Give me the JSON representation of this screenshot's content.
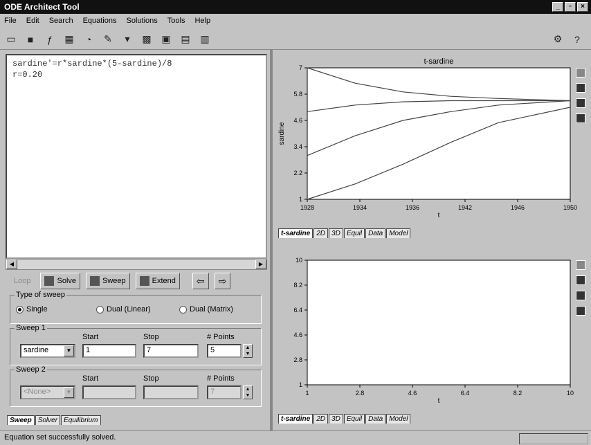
{
  "window": {
    "title": "ODE Architect Tool",
    "controls": [
      "_",
      "▫",
      "×"
    ]
  },
  "menu": [
    "File",
    "Edit",
    "Search",
    "Equations",
    "Solutions",
    "Tools",
    "Help"
  ],
  "editor": {
    "lines": [
      "sardine'=r*sardine*(5-sardine)/8",
      "r=0.20"
    ]
  },
  "actions": {
    "solve": "Solve",
    "sweep": "Sweep",
    "extend": "Extend",
    "back": "⇦",
    "forward": "⇨",
    "disabled": "Loop"
  },
  "sweep": {
    "type_label": "Type of sweep",
    "types": [
      "Single",
      "Dual (Linear)",
      "Dual (Matrix)"
    ],
    "selected_type": "Single",
    "sweep1": {
      "label": "Sweep 1",
      "start_label": "Start",
      "stop_label": "Stop",
      "points_label": "# Points",
      "variable": "sardine",
      "start": "1",
      "stop": "7",
      "points": "5"
    },
    "sweep2": {
      "label": "Sweep 2",
      "start_label": "Start",
      "stop_label": "Stop",
      "points_label": "# Points",
      "variable": "<None>",
      "start": "",
      "stop": "",
      "points": "7"
    }
  },
  "left_tabs": [
    "Sweep",
    "Solver",
    "Equilibrium"
  ],
  "top_plot": {
    "tabs": [
      "t-sardine",
      "2D",
      "3D",
      "Equil",
      "Data",
      "Model"
    ]
  },
  "bottom_plot": {
    "tabs": [
      "t-sardine",
      "2D",
      "3D",
      "Equil",
      "Data",
      "Model"
    ]
  },
  "status": {
    "text": "Equation set successfully solved."
  },
  "chart_data": [
    {
      "type": "line",
      "title": "t-sardine",
      "xlabel": "t",
      "ylabel": "sardine",
      "xlim": [
        1928,
        1950
      ],
      "ylim": [
        1,
        7
      ],
      "xticks": [
        "1928",
        "1934",
        "1936",
        "1942",
        "1946",
        "1950"
      ],
      "yticks": [
        "1",
        "2.2",
        "3.4",
        "4.6",
        "5.8",
        "7"
      ],
      "series": [
        {
          "x": [
            1928,
            1932,
            1936,
            1940,
            1944,
            1950
          ],
          "values": [
            7,
            6.3,
            5.9,
            5.7,
            5.6,
            5.5
          ]
        },
        {
          "x": [
            1928,
            1932,
            1936,
            1940,
            1944,
            1950
          ],
          "values": [
            5.0,
            5.3,
            5.45,
            5.5,
            5.5,
            5.5
          ]
        },
        {
          "x": [
            1928,
            1932,
            1936,
            1940,
            1944,
            1950
          ],
          "values": [
            3.0,
            3.9,
            4.6,
            5.0,
            5.3,
            5.5
          ]
        },
        {
          "x": [
            1928,
            1932,
            1936,
            1940,
            1944,
            1950
          ],
          "values": [
            1.0,
            1.7,
            2.6,
            3.6,
            4.5,
            5.2
          ]
        }
      ],
      "grid": false
    },
    {
      "type": "line",
      "xlabel": "t",
      "xlim": [
        1,
        10
      ],
      "ylim": [
        1,
        10
      ],
      "xticks": [
        "1",
        "2.8",
        "4.6",
        "6.4",
        "8.2",
        "10"
      ],
      "yticks": [
        "1",
        "2.8",
        "4.6",
        "6.4",
        "8.2",
        "10"
      ],
      "series": [],
      "grid": false
    }
  ],
  "colors": {
    "titlebar": "#111111",
    "plot_bg": "#ffffff",
    "window": "#c3c3c3",
    "curve": "#444444"
  }
}
